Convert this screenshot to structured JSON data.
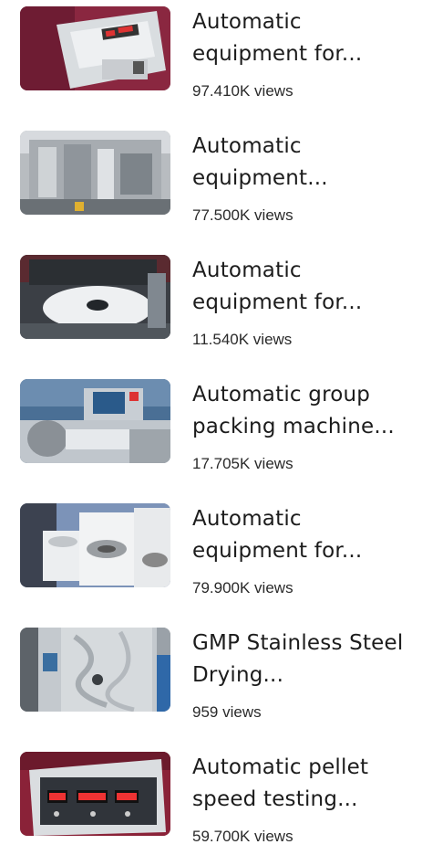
{
  "items": [
    {
      "title": "Automatic equipment for...",
      "views": "97.410K views",
      "thumb_icon": "tablet-hardness-tester-image",
      "views_suffix": ""
    },
    {
      "title": "Automatic equipment...",
      "views": "77.500K views",
      "thumb_icon": "blister-packing-machine-image"
    },
    {
      "title": "Automatic equipment for...",
      "views": "11.540K views",
      "thumb_icon": "rotary-capping-machine-image"
    },
    {
      "title": "Automatic group packing machine...",
      "views": "17.705K views",
      "thumb_icon": "group-packing-machine-image"
    },
    {
      "title": "Automatic equipment for...",
      "views": "79.900K views",
      "thumb_icon": "centrifuge-equipment-image"
    },
    {
      "title": "GMP Stainless Steel Drying...",
      "views": "959 views",
      "thumb_icon": "stainless-drying-oven-image"
    },
    {
      "title": "Automatic pellet speed testing...",
      "views": "59.700K views",
      "thumb_icon": "pellet-speed-tester-image"
    }
  ],
  "colors": {
    "title": "#1c1c1c",
    "views": "#2a2a2a",
    "background": "#ffffff"
  }
}
